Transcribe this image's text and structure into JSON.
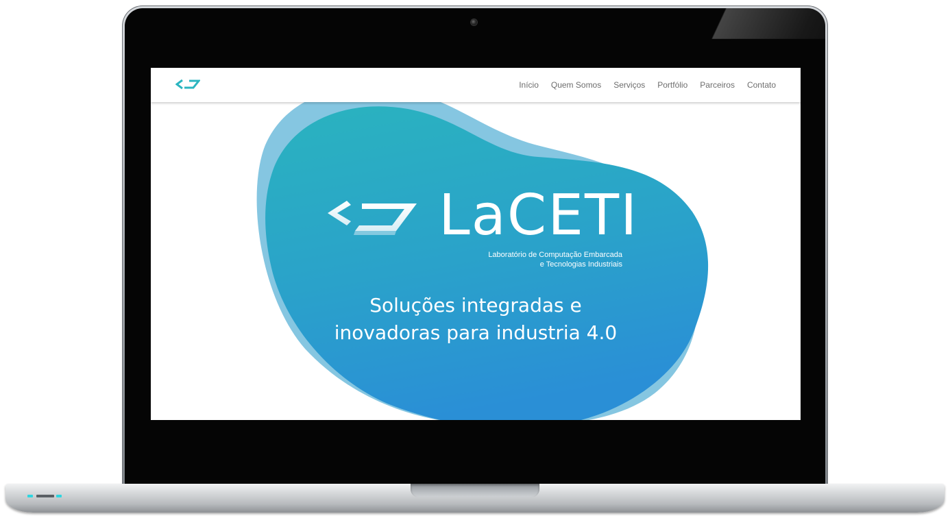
{
  "nav": {
    "logo_icon": "code-brackets-icon",
    "links": [
      "Início",
      "Quem Somos",
      "Serviços",
      "Portfólio",
      "Parceiros",
      "Contato"
    ]
  },
  "hero": {
    "brand_name": "LaCETI",
    "brand_subtitle_line1": "Laboratório de Computação Embarcada",
    "brand_subtitle_line2": "e Tecnologias Industriais",
    "headline_line1": "Soluções integradas e",
    "headline_line2": "inovadoras para industria 4.0"
  },
  "colors": {
    "accent": "#2bb5c0",
    "blob_top": "#2ab3bf",
    "blob_bottom": "#2a8fd6",
    "blob_back": "#78c0de",
    "nav_text": "#6d6d6d",
    "led": "#2fd6e0"
  }
}
